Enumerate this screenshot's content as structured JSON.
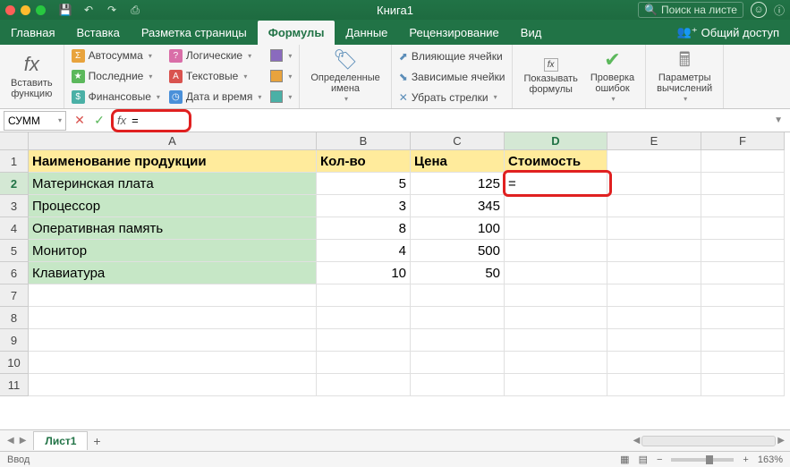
{
  "titlebar": {
    "doc_title": "Книга1",
    "search_placeholder": "Поиск на листе"
  },
  "tabs": {
    "items": [
      "Главная",
      "Вставка",
      "Разметка страницы",
      "Формулы",
      "Данные",
      "Рецензирование",
      "Вид"
    ],
    "active": "Формулы",
    "share": "Общий доступ"
  },
  "ribbon": {
    "insert_fn": "Вставить\nфункцию",
    "autosum": "Автосумма",
    "recent": "Последние",
    "financial": "Финансовые",
    "logical": "Логические",
    "text": "Текстовые",
    "datetime": "Дата и время",
    "defined_names": "Определенные\nимена",
    "trace_precedents": "Влияющие ячейки",
    "trace_dependents": "Зависимые ячейки",
    "remove_arrows": "Убрать стрелки",
    "show_formulas": "Показывать\nформулы",
    "error_check": "Проверка\nошибок",
    "calc_options": "Параметры\nвычислений"
  },
  "formula_bar": {
    "name_box": "СУММ",
    "formula": "="
  },
  "columns": [
    "A",
    "B",
    "C",
    "D",
    "E",
    "F"
  ],
  "active_col": "D",
  "active_row": 2,
  "active_cell_value": "=",
  "headers": {
    "A": "Наименование продукции",
    "B": "Кол-во",
    "C": "Цена",
    "D": "Стоимость"
  },
  "data_rows": [
    {
      "name": "Материнская плата",
      "qty": 5,
      "price": 125
    },
    {
      "name": "Процессор",
      "qty": 3,
      "price": 345
    },
    {
      "name": "Оперативная память",
      "qty": 8,
      "price": 100
    },
    {
      "name": "Монитор",
      "qty": 4,
      "price": 500
    },
    {
      "name": "Клавиатура",
      "qty": 10,
      "price": 50
    }
  ],
  "sheet": {
    "name": "Лист1"
  },
  "status": {
    "mode": "Ввод",
    "zoom": "163%"
  }
}
